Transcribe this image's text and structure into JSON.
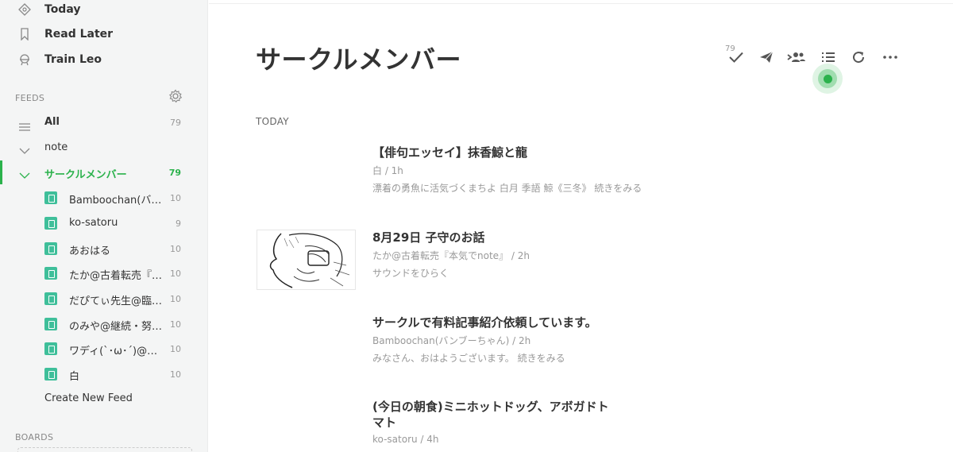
{
  "sidebar": {
    "nav": [
      {
        "label": "Today",
        "icon": "today-icon"
      },
      {
        "label": "Read Later",
        "icon": "bookmark-icon"
      },
      {
        "label": "Train Leo",
        "icon": "leo-icon"
      }
    ],
    "feeds_title": "FEEDS",
    "feeds": [
      {
        "label": "All",
        "count": "79"
      },
      {
        "label": "note",
        "count": ""
      },
      {
        "label": "サークルメンバー",
        "count": "79"
      }
    ],
    "sources": [
      {
        "label": "Bamboochan(バ…",
        "count": "10"
      },
      {
        "label": "ko-satoru",
        "count": "9"
      },
      {
        "label": "あおはる",
        "count": "10"
      },
      {
        "label": "たか@古着転売『…",
        "count": "10"
      },
      {
        "label": "だぴてぃ先生@臨…",
        "count": "10"
      },
      {
        "label": "のみや@継続・努…",
        "count": "10"
      },
      {
        "label": "ワディ(`･ω･´)@…",
        "count": "10"
      },
      {
        "label": "白",
        "count": "10"
      }
    ],
    "create_feed": "Create New Feed",
    "boards_title": "BOARDS"
  },
  "main": {
    "title": "サークルメンバー",
    "unread_count": "79",
    "day_label": "TODAY",
    "entries": [
      {
        "title": "【俳句エッセイ】抹香鯨と龍",
        "meta": "白 / 1h",
        "summary": "漂着の勇魚に活気づくまちよ 白月 季語 鯨《三冬》 続きをみる",
        "has_thumb": false
      },
      {
        "title": "8月29日 子守のお話",
        "meta": "たか@古着転売『本気でnote』 / 2h",
        "summary": "サウンドをひらく",
        "has_thumb": true
      },
      {
        "title": "サークルで有料記事紹介依頼しています。",
        "meta": "Bamboochan(バンブーちゃん) / 2h",
        "summary": "みなさん、おはようございます。 続きをみる",
        "has_thumb": false
      },
      {
        "title": "(今日の朝食)ミニホットドッグ、アボガドトマト",
        "meta": "ko-satoru / 4h",
        "summary": "",
        "has_thumb": false
      }
    ]
  },
  "colors": {
    "accent": "#2bb24c",
    "source_icon": "#3fbf9a"
  }
}
